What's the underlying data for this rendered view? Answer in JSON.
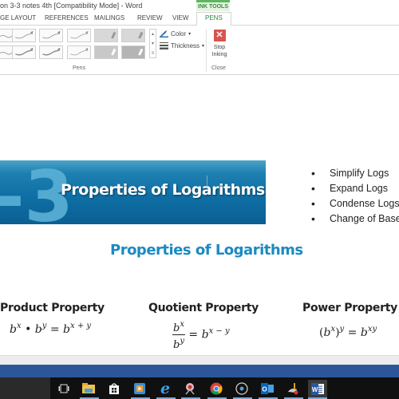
{
  "window": {
    "title": "on 3-3 notes 4th [Compatibility Mode] - Word",
    "context_tab_group": "INK TOOLS"
  },
  "tabs": [
    {
      "label": "GE LAYOUT",
      "active": false
    },
    {
      "label": "REFERENCES",
      "active": false
    },
    {
      "label": "MAILINGS",
      "active": false
    },
    {
      "label": "REVIEW",
      "active": false
    },
    {
      "label": "VIEW",
      "active": false
    },
    {
      "label": "PENS",
      "active": true
    }
  ],
  "ribbon": {
    "pens_group_label": "Pens",
    "color_label": "Color",
    "thickness_label": "Thickness",
    "stop_inking_label_1": "Stop",
    "stop_inking_label_2": "Inking",
    "close_group_label": "Close",
    "stop_icon": "x-icon",
    "accent_color": "#d9534f"
  },
  "document": {
    "banner": {
      "number": "-3",
      "title": "Properties of Logarithms",
      "color": "#0e6ea4"
    },
    "bullets": [
      "Simplify Logs",
      "Expand Logs",
      "Condense Logs",
      "Change of Base"
    ],
    "subtitle": "Properties of Logarithms",
    "subtitle_color": "#1b8ac2",
    "properties": [
      {
        "heading": "Product Property",
        "formula": "b^x · b^y = b^(x+y)"
      },
      {
        "heading": "Quotient Property",
        "formula": "b^x / b^y = b^(x−y)"
      },
      {
        "heading": "Power Property",
        "formula": "(b^x)^y = b^(xy)"
      }
    ]
  },
  "taskbar": {
    "icons": [
      {
        "name": "task-view-icon",
        "active": false
      },
      {
        "name": "file-explorer-icon",
        "active": true
      },
      {
        "name": "store-icon",
        "active": false
      },
      {
        "name": "media-player-icon",
        "active": true
      },
      {
        "name": "edge-icon",
        "active": true
      },
      {
        "name": "snipping-tool-icon",
        "active": true
      },
      {
        "name": "chrome-icon",
        "active": true
      },
      {
        "name": "obs-icon",
        "active": true
      },
      {
        "name": "outlook-icon",
        "active": true
      },
      {
        "name": "paint-icon",
        "active": true
      },
      {
        "name": "word-icon",
        "active": true
      }
    ]
  }
}
